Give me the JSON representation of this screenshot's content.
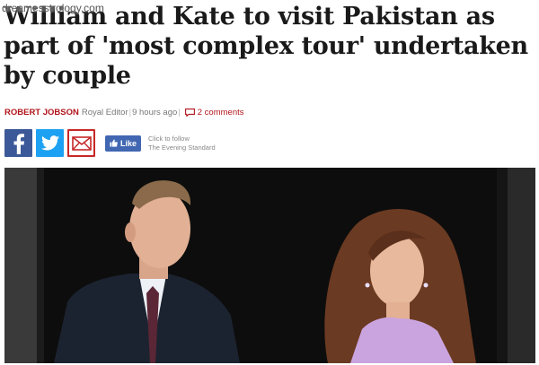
{
  "watermark": "dreamesstrology.com",
  "headline": "William and Kate to visit Pakistan as part of 'most complex tour' undertaken by couple",
  "byline": {
    "author": "ROBERT JOBSON",
    "role": "Royal Editor",
    "time": "9 hours ago",
    "comments": "2 comments"
  },
  "social": {
    "like_label": "Like",
    "follow_line1": "Click to follow",
    "follow_line2": "The Evening Standard",
    "icons": [
      "facebook-icon",
      "twitter-icon",
      "email-icon",
      "thumbs-up-icon"
    ]
  },
  "colors": {
    "author_red": "#b1141b",
    "facebook_blue": "#3b5998",
    "twitter_blue": "#1da1f2",
    "email_red": "#c62828",
    "like_blue": "#4267b2"
  }
}
